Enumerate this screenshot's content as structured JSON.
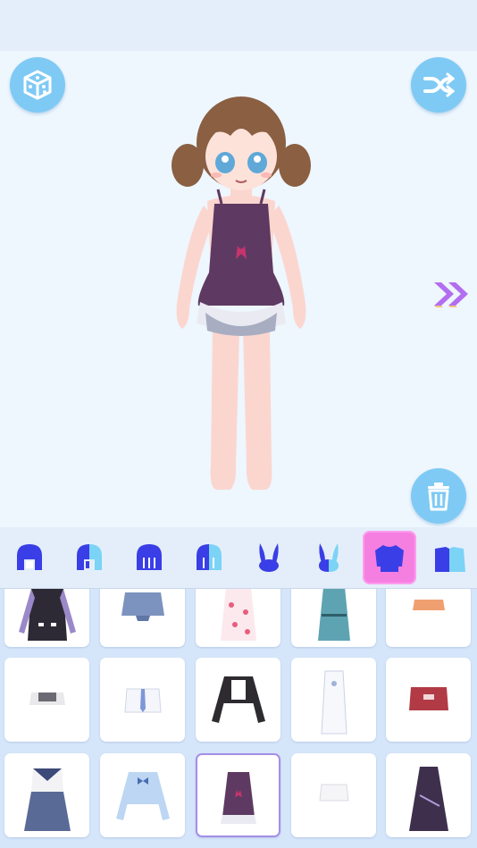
{
  "buttons": {
    "randomize_icon": "dice-icon",
    "shuffle_icon": "shuffle-icon",
    "next_icon": "double-chevron-right-icon",
    "delete_icon": "trash-icon"
  },
  "tabs": [
    {
      "id": "hair-front",
      "icon": "hair-front-icon"
    },
    {
      "id": "hair-front-alt",
      "icon": "hair-front-alt-icon"
    },
    {
      "id": "hair-back",
      "icon": "hair-back-icon"
    },
    {
      "id": "hair-back-alt",
      "icon": "hair-back-alt-icon"
    },
    {
      "id": "ears",
      "icon": "bunny-ears-icon"
    },
    {
      "id": "ears-alt",
      "icon": "bunny-ears-alt-icon"
    },
    {
      "id": "tops",
      "icon": "sweater-icon",
      "active": true
    },
    {
      "id": "outfits",
      "icon": "outfit-icon"
    }
  ],
  "items": [
    {
      "name": "striped-sleeve-dress",
      "selected": false
    },
    {
      "name": "denim-shirt",
      "selected": false
    },
    {
      "name": "strawberry-dress",
      "selected": false
    },
    {
      "name": "teal-dress",
      "selected": false
    },
    {
      "name": "orange-crop-top",
      "selected": false
    },
    {
      "name": "gray-crop-top",
      "selected": false
    },
    {
      "name": "white-shirt-tie",
      "selected": false
    },
    {
      "name": "black-jacket",
      "selected": false
    },
    {
      "name": "white-qipao",
      "selected": false
    },
    {
      "name": "red-offshoulder-top",
      "selected": false
    },
    {
      "name": "sailor-dress",
      "selected": false
    },
    {
      "name": "blue-bow-blouse",
      "selected": false
    },
    {
      "name": "purple-camisole-dress",
      "selected": true
    },
    {
      "name": "white-wrap-top",
      "selected": false
    },
    {
      "name": "purple-chain-dress",
      "selected": false
    }
  ],
  "colors": {
    "accent_blue": "#7fcaf4",
    "active_tab": "#f57fe0",
    "tab_icon_blue": "#3a3ee6",
    "selected_outline": "#a58ee8",
    "next_arrows": "#b36ef0"
  }
}
